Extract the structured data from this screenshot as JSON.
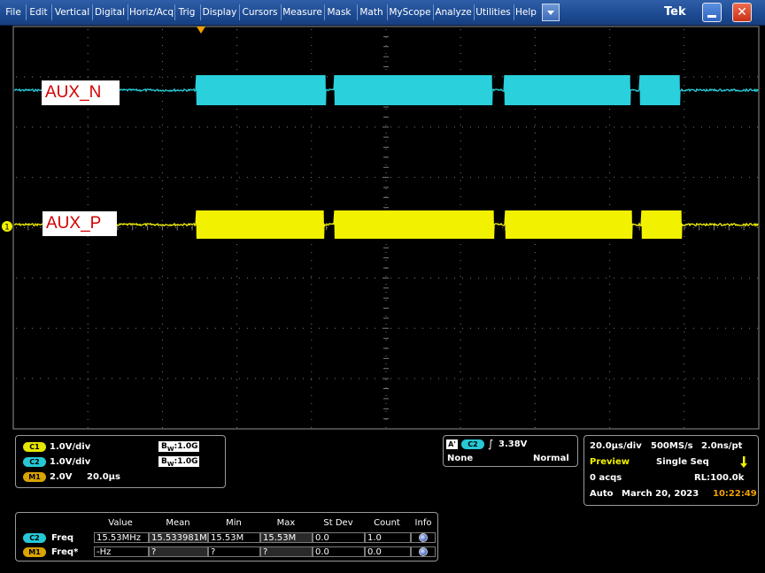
{
  "menu": {
    "items": [
      "File",
      "Edit",
      "Vertical",
      "Digital",
      "Horiz/Acq",
      "Trig",
      "Display",
      "Cursors",
      "Measure",
      "Mask",
      "Math",
      "MyScope",
      "Analyze",
      "Utilities",
      "Help"
    ],
    "brand": "Tek",
    "close_glyph": "✕"
  },
  "display": {
    "grid_color": "#7a7a7a",
    "ch1_color": "#f2f200",
    "ch2_color": "#2ad0dc",
    "trigger_marker_color": "#f0a000",
    "ch1_marker": "1",
    "labels": {
      "aux_n": "AUX_N",
      "aux_p": "AUX_P"
    }
  },
  "channels": {
    "c1": {
      "badge": "C1",
      "scale": "1.0V/div",
      "bw_prefix": "B",
      "bw_sub": "W",
      "bw": ":1.0G"
    },
    "c2": {
      "badge": "C2",
      "scale": "1.0V/div",
      "bw_prefix": "B",
      "bw_sub": "W",
      "bw": ":1.0G"
    },
    "m1": {
      "badge": "M1",
      "scale": "2.0V",
      "time": "20.0µs"
    }
  },
  "trigger": {
    "badge_a": "A'",
    "source_badge": "C2",
    "slope_glyph": "∫",
    "level": "3.38V",
    "coupling": "None",
    "mode": "Normal"
  },
  "timebase": {
    "horizontal": "20.0µs/div",
    "sample_rate": "500MS/s",
    "resolution": "2.0ns/pt",
    "state": "Preview",
    "acq_mode": "Single Seq",
    "acqs": "0 acqs",
    "record_length": "RL:100.0k",
    "trigger_mode": "Auto",
    "date": "March 20, 2023",
    "time": "10:22:49"
  },
  "measurements": {
    "headers": [
      "Value",
      "Mean",
      "Min",
      "Max",
      "St Dev",
      "Count",
      "Info"
    ],
    "rows": [
      {
        "badge": "C2",
        "name": "Freq",
        "value": "15.53MHz",
        "mean": "15.533981M",
        "min": "15.53M",
        "max": "15.53M",
        "stdev": "0.0",
        "count": "1.0"
      },
      {
        "badge": "M1",
        "name": "Freq*",
        "value": "-Hz",
        "mean": "?",
        "min": "?",
        "max": "?",
        "stdev": "0.0",
        "count": "0.0"
      }
    ]
  }
}
